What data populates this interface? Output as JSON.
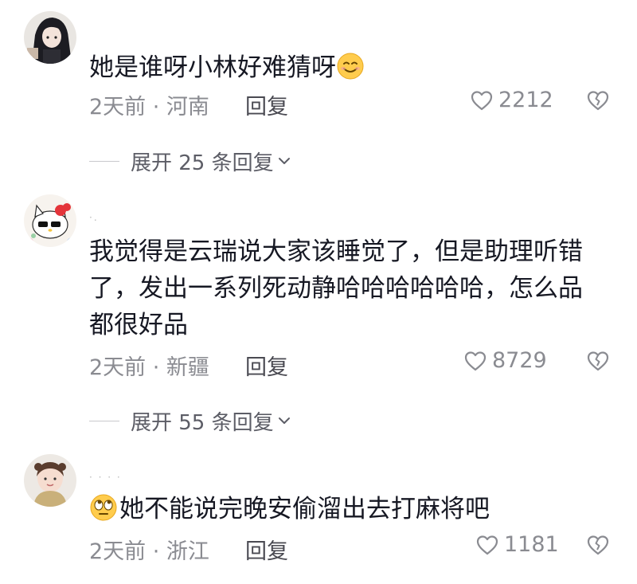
{
  "comments": [
    {
      "text": "她是谁呀小林好难猜呀",
      "time_location": "2天前 · 河南",
      "reply_label": "回复",
      "likes": "2212",
      "expand_label": "展开 25 条回复",
      "username_stub": ""
    },
    {
      "text": "我觉得是云瑞说大家该睡觉了，但是助理听错了，发出一系列死动静哈哈哈哈哈哈，怎么品都很好品",
      "time_location": "2天前 · 新疆",
      "reply_label": "回复",
      "likes": "8729",
      "expand_label": "展开 55 条回复",
      "username_stub": "·."
    },
    {
      "text": "她不能说完晚安偷溜出去打麻将吧",
      "time_location": "2天前 · 浙江",
      "reply_label": "回复",
      "likes": "1181",
      "username_stub": "· · · ·"
    }
  ],
  "icons": {
    "like": "heart-outline-icon",
    "dislike": "broken-heart-outline-icon",
    "expand": "chevron-down-icon",
    "emoji_1": "smiling-face-emoji",
    "emoji_3": "rolling-eyes-emoji"
  },
  "colors": {
    "text": "#161823",
    "meta": "#8a8b91",
    "reply": "#4a4a52",
    "expand": "#5c5d66"
  }
}
